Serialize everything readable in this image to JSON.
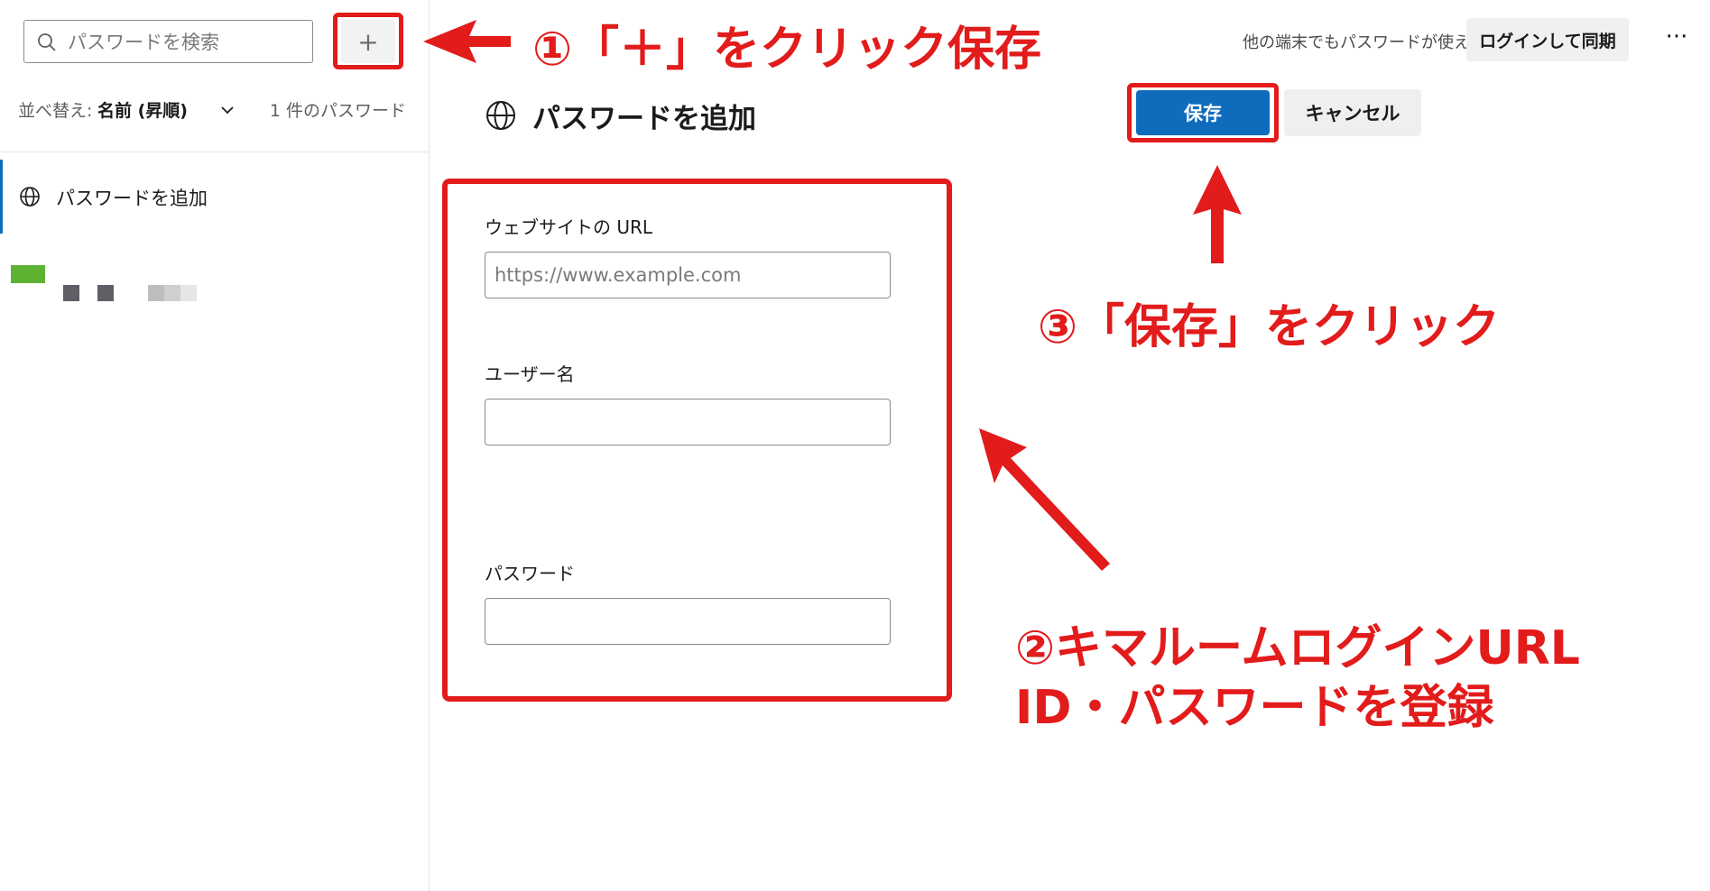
{
  "search": {
    "placeholder": "パスワードを検索"
  },
  "add_button": {
    "label": "+"
  },
  "sort": {
    "label": "並べ替え:",
    "value": "名前 (昇順)",
    "count": "1 件のパスワード"
  },
  "sidebar": {
    "items": [
      {
        "label": "パスワードを追加"
      }
    ]
  },
  "header": {
    "sync_text": "他の端末でもパスワードが使える",
    "sync_button": "ログインして同期",
    "more": "···"
  },
  "panel": {
    "title": "パスワードを追加",
    "save": "保存",
    "cancel": "キャンセル",
    "fields": {
      "url_label": "ウェブサイトの URL",
      "url_placeholder": "https://www.example.com",
      "username_label": "ユーザー名",
      "password_label": "パスワード"
    }
  },
  "annotations": {
    "step1": "①「＋」をクリック保存",
    "step3": "③「保存」をクリック",
    "step2_line1": "②キマルームログインURL",
    "step2_line2": "ID・パスワードを登録"
  },
  "colors": {
    "accent": "#0f6cbd",
    "annotation": "#e21b1b"
  }
}
